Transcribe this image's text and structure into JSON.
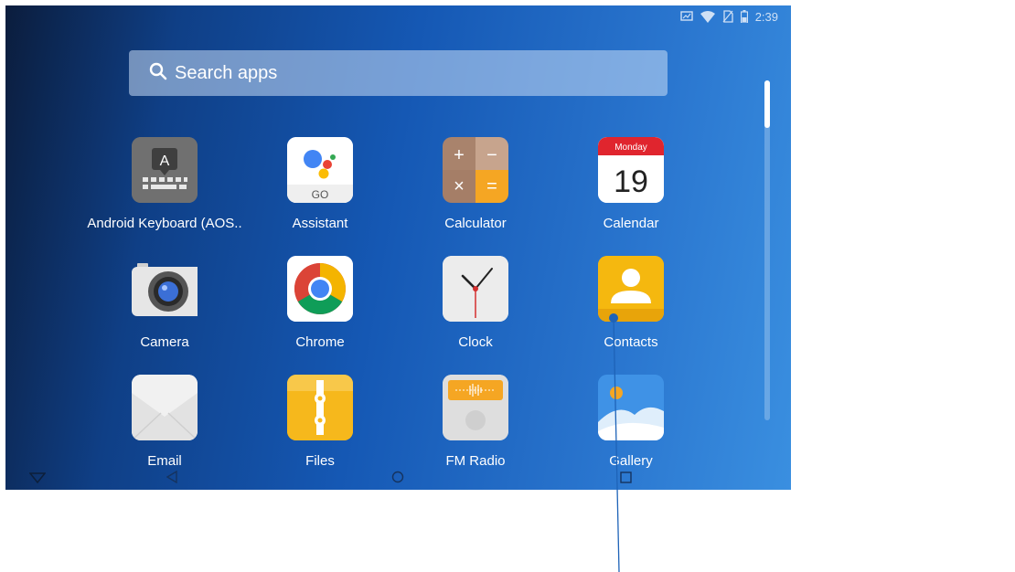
{
  "status_bar": {
    "time": "2:39",
    "icons": [
      "cast-icon",
      "wifi-icon",
      "no-sim-icon",
      "battery-icon"
    ]
  },
  "search": {
    "placeholder": "Search apps",
    "icon": "search-icon"
  },
  "apps": [
    {
      "label": "Android Keyboard (AOS..",
      "icon": "keyboard-icon",
      "key_letter": "A"
    },
    {
      "label": "Assistant",
      "icon": "assistant-icon",
      "sub": "GO"
    },
    {
      "label": "Calculator",
      "icon": "calculator-icon",
      "symbols": [
        "+",
        "−",
        "×",
        "="
      ]
    },
    {
      "label": "Calendar",
      "icon": "calendar-icon",
      "weekday": "Monday",
      "day": "19"
    },
    {
      "label": "Camera",
      "icon": "camera-icon"
    },
    {
      "label": "Chrome",
      "icon": "chrome-icon"
    },
    {
      "label": "Clock",
      "icon": "clock-icon"
    },
    {
      "label": "Contacts",
      "icon": "contacts-icon"
    },
    {
      "label": "Email",
      "icon": "email-icon"
    },
    {
      "label": "Files",
      "icon": "files-icon"
    },
    {
      "label": "FM Radio",
      "icon": "radio-icon"
    },
    {
      "label": "Gallery",
      "icon": "gallery-icon"
    }
  ],
  "nav_bar": {
    "buttons": [
      "down-triangle-icon",
      "back-icon",
      "home-icon",
      "recents-icon"
    ]
  },
  "colors": {
    "annotation_line": "#1e63b8",
    "search_bg": "#c8dcf5",
    "calendar_red": "#e0252e",
    "contacts_yellow": "#f5b80f"
  }
}
